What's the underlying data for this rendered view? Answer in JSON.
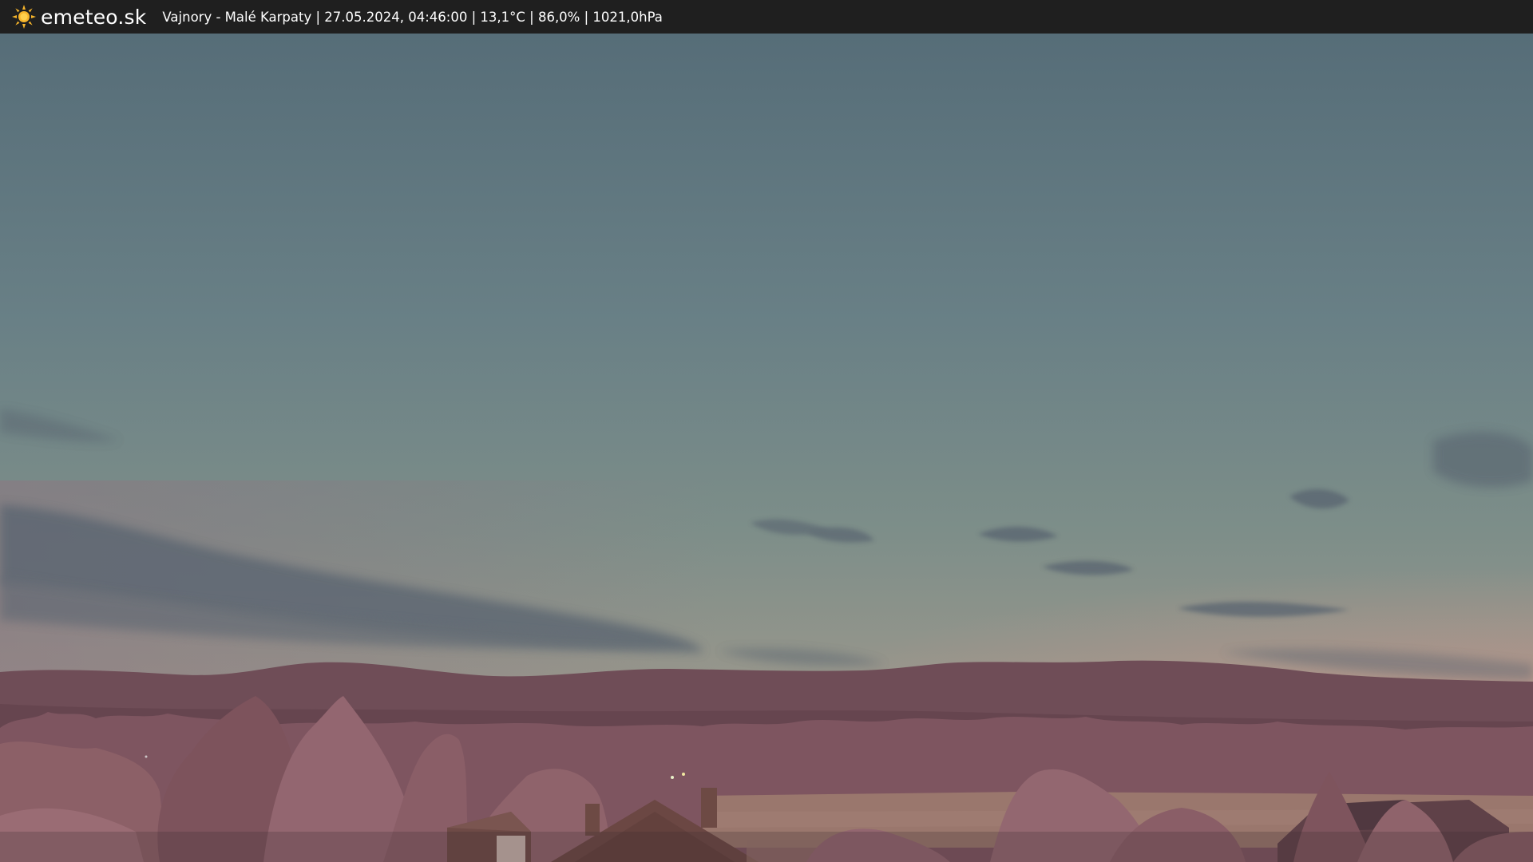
{
  "header": {
    "logo_icon": "sun-icon",
    "brand": "emeteo.sk",
    "info": "Vajnory - Malé Karpaty | 27.05.2024, 04:46:00 | 13,1°C | 86,0% | 1021,0hPa"
  },
  "colors": {
    "header_bg": "#1f1f1f",
    "sun_yellow": "#f7b52b",
    "sky_top": "#566d78",
    "sky_mid": "#7b8d88",
    "sky_horizon": "#b3998f",
    "hills": "#6f4d57",
    "foliage": "#8c6067",
    "field": "#9a776d"
  }
}
